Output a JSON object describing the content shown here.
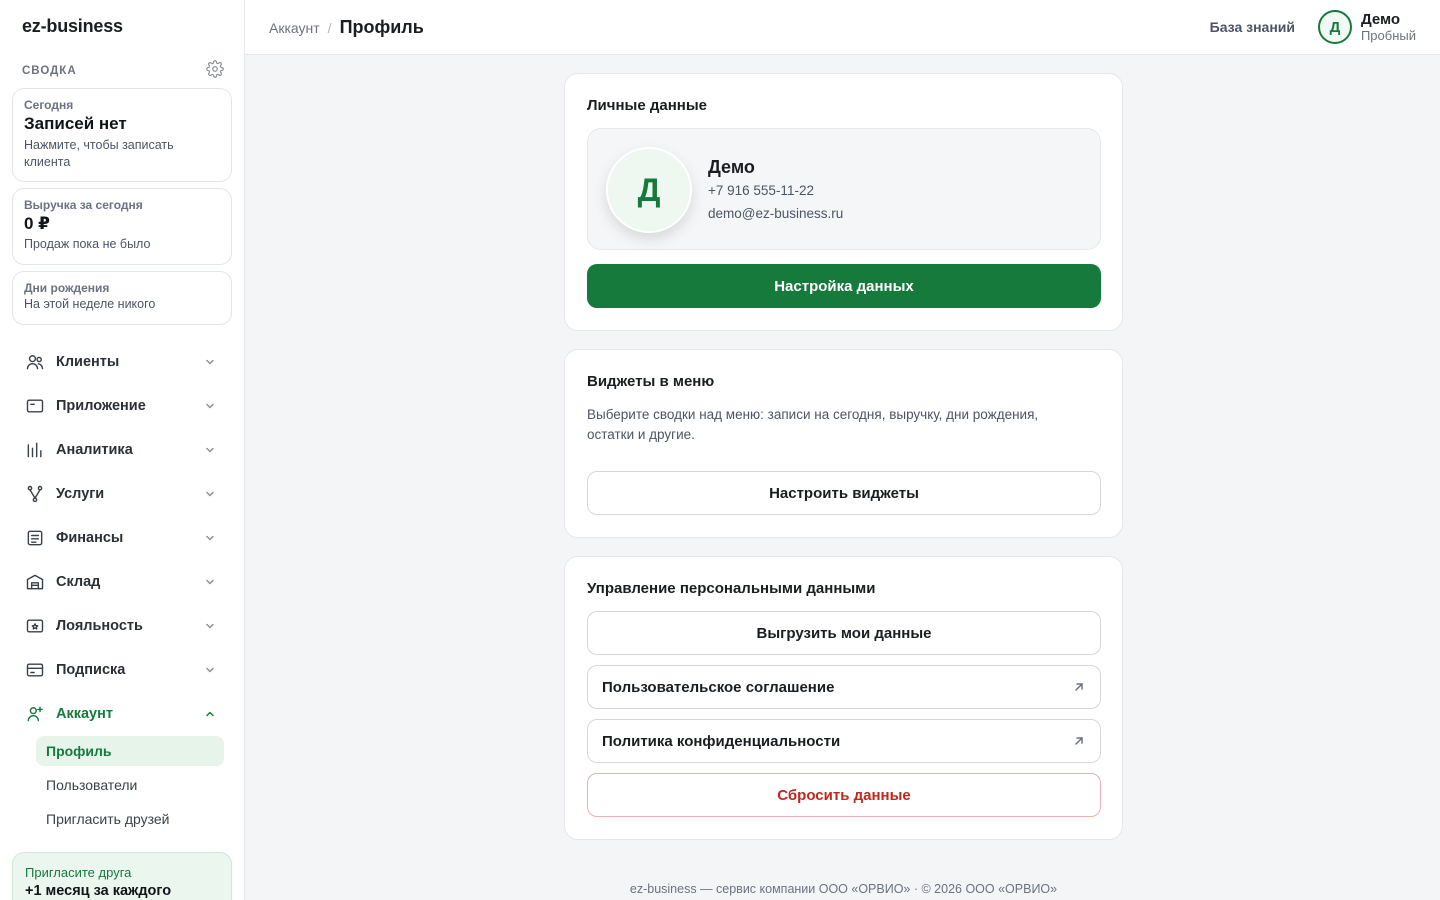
{
  "app": {
    "logo": "ez-business"
  },
  "summary": {
    "title": "СВОДКА",
    "cards": [
      {
        "label": "Сегодня",
        "value": "Записей нет",
        "note": "Нажмите, чтобы записать клиента"
      },
      {
        "label": "Выручка за сегодня",
        "value": "0 ₽",
        "note": "Продаж пока не было"
      },
      {
        "label": "Дни рождения",
        "note": "На этой неделе никого"
      }
    ]
  },
  "nav": {
    "items": [
      {
        "label": "Клиенты",
        "icon": "users-icon"
      },
      {
        "label": "Приложение",
        "icon": "app-card-icon"
      },
      {
        "label": "Аналитика",
        "icon": "bar-chart-icon"
      },
      {
        "label": "Услуги",
        "icon": "branch-icon"
      },
      {
        "label": "Финансы",
        "icon": "document-icon"
      },
      {
        "label": "Склад",
        "icon": "warehouse-icon"
      },
      {
        "label": "Лояльность",
        "icon": "loyalty-icon"
      },
      {
        "label": "Подписка",
        "icon": "credit-card-icon"
      },
      {
        "label": "Аккаунт",
        "icon": "user-plus-icon",
        "active": true
      }
    ],
    "account_sub": [
      {
        "label": "Профиль",
        "active": true
      },
      {
        "label": "Пользователи"
      },
      {
        "label": "Пригласить друзей"
      }
    ]
  },
  "invite": {
    "line1": "Пригласите друга",
    "line2": "+1 месяц за каждого"
  },
  "topbar": {
    "crumb_parent": "Аккаунт",
    "crumb_sep": "/",
    "crumb_current": "Профиль",
    "knowledge_base": "База знаний",
    "user_initial": "Д",
    "user_name": "Демо",
    "user_plan": "Пробный"
  },
  "personal": {
    "title": "Личные данные",
    "initial": "Д",
    "name": "Демо",
    "phone": "+7 916 555-11-22",
    "email": "demo@ez-business.ru",
    "button": "Настройка данных"
  },
  "widgets": {
    "title": "Виджеты в меню",
    "description": "Выберите сводки над меню: записи на сегодня, выручку, дни рождения, остатки и другие.",
    "button": "Настроить виджеты"
  },
  "data_mgmt": {
    "title": "Управление персональными данными",
    "export": "Выгрузить мои данные",
    "agreement": "Пользовательское соглашение",
    "privacy": "Политика конфиденциальности",
    "reset": "Сбросить данные"
  },
  "footer": "ez-business — сервис компании ООО «ОРВИО» · © 2026 ООО «ОРВИО»",
  "colors": {
    "accent": "#157a3c",
    "danger": "#c0271d",
    "accent_soft": "#e6f4ea"
  }
}
